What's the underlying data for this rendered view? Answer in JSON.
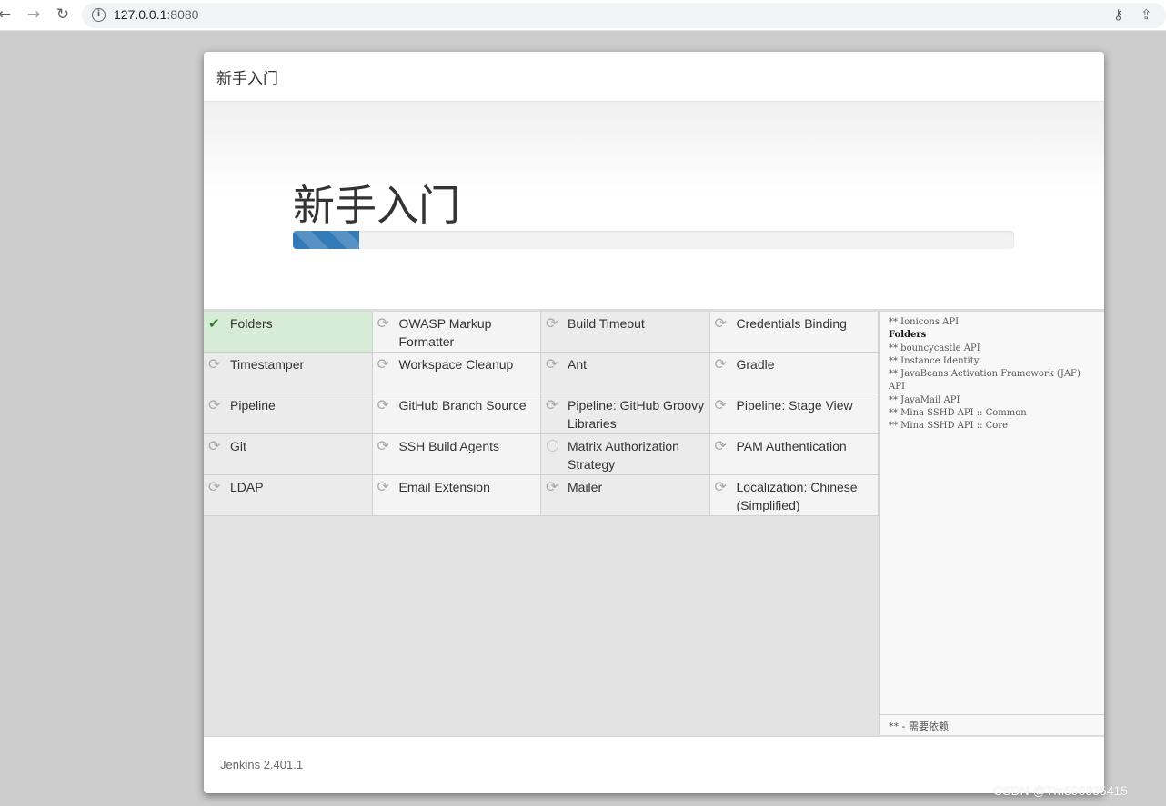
{
  "browser": {
    "back_icon": "←",
    "forward_icon": "→",
    "reload_icon": "↻",
    "url_host": "127.0.0.1",
    "url_port": ":8080",
    "info_icon": "i",
    "key_icon": "⚷",
    "share_icon": "⇪"
  },
  "dialog": {
    "header_title": "新手入门",
    "hero_title": "新手入门",
    "progress_percent": 9.2,
    "plugins": [
      {
        "name": "Folders",
        "status": "success",
        "icon": "✔"
      },
      {
        "name": "OWASP Markup Formatter",
        "status": "queued",
        "icon": "⟳"
      },
      {
        "name": "Build Timeout",
        "status": "queued",
        "icon": "⟳"
      },
      {
        "name": "Credentials Binding",
        "status": "queued",
        "icon": "⟳"
      },
      {
        "name": "Timestamper",
        "status": "queued",
        "icon": "⟳"
      },
      {
        "name": "Workspace Cleanup",
        "status": "installing",
        "icon": "⟳"
      },
      {
        "name": "Ant",
        "status": "queued",
        "icon": "⟳"
      },
      {
        "name": "Gradle",
        "status": "installing",
        "icon": "⟳"
      },
      {
        "name": "Pipeline",
        "status": "installing",
        "icon": "⟳"
      },
      {
        "name": "GitHub Branch Source",
        "status": "queued",
        "icon": "⟳"
      },
      {
        "name": "Pipeline: GitHub Groovy Libraries",
        "status": "installing",
        "icon": "⟳"
      },
      {
        "name": "Pipeline: Stage View",
        "status": "installing",
        "icon": "⟳"
      },
      {
        "name": "Git",
        "status": "queued",
        "icon": "⟳"
      },
      {
        "name": "SSH Build Agents",
        "status": "queued",
        "icon": "⟳"
      },
      {
        "name": "Matrix Authorization Strategy",
        "status": "pending",
        "icon": ""
      },
      {
        "name": "PAM Authentication",
        "status": "queued",
        "icon": "⟳"
      },
      {
        "name": "LDAP",
        "status": "queued",
        "icon": "⟳"
      },
      {
        "name": "Email Extension",
        "status": "installing",
        "icon": "⟳"
      },
      {
        "name": "Mailer",
        "status": "queued",
        "icon": "⟳"
      },
      {
        "name": "Localization: Chinese (Simplified)",
        "status": "queued",
        "icon": "⟳"
      }
    ],
    "log": [
      {
        "text": "** Ionicons API",
        "strong": false
      },
      {
        "text": "Folders",
        "strong": true
      },
      {
        "text": "** bouncycastle API",
        "strong": false
      },
      {
        "text": "** Instance Identity",
        "strong": false
      },
      {
        "text": "** JavaBeans Activation Framework (JAF) API",
        "strong": false
      },
      {
        "text": "** JavaMail API",
        "strong": false
      },
      {
        "text": "** Mina SSHD API :: Common",
        "strong": false
      },
      {
        "text": "** Mina SSHD API :: Core",
        "strong": false
      }
    ],
    "log_legend": "** - 需要依赖",
    "footer_version": "Jenkins 2.401.1"
  },
  "watermark": "CSDN @Tm598935415",
  "colors": {
    "success_bg": "#d7ecd7",
    "success_icon": "#2d7d2d",
    "progress": "#337ab7"
  }
}
